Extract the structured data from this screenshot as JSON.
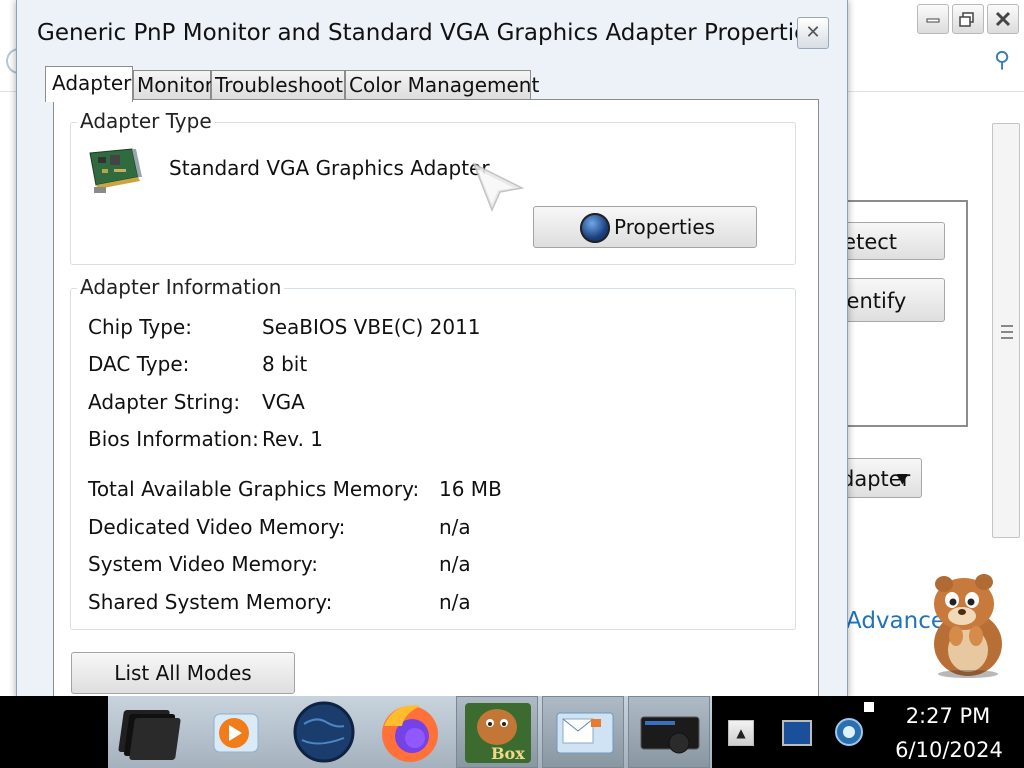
{
  "dialog": {
    "title": "Generic PnP Monitor and Standard VGA Graphics Adapter Properties",
    "close_glyph": "✕"
  },
  "tabs": [
    {
      "label": "Adapter",
      "active": true
    },
    {
      "label": "Monitor",
      "active": false
    },
    {
      "label": "Troubleshoot",
      "active": false
    },
    {
      "label": "Color Management",
      "active": false
    }
  ],
  "adapter_type": {
    "legend": "Adapter Type",
    "name": "Standard VGA Graphics Adapter",
    "properties_label": "Properties",
    "icon": "graphics-card-icon"
  },
  "adapter_info": {
    "legend": "Adapter Information",
    "rows": [
      {
        "label": "Chip Type:",
        "value": "SeaBIOS VBE(C) 2011"
      },
      {
        "label": "DAC Type:",
        "value": "8 bit"
      },
      {
        "label": "Adapter String:",
        "value": "VGA"
      },
      {
        "label": "Bios Information:",
        "value": "Rev. 1"
      }
    ],
    "memory": [
      {
        "label": "Total Available Graphics Memory:",
        "value": "16 MB"
      },
      {
        "label": "Dedicated Video Memory:",
        "value": "n/a"
      },
      {
        "label": "System Video Memory:",
        "value": "n/a"
      },
      {
        "label": "Shared System Memory:",
        "value": "n/a"
      }
    ]
  },
  "list_all_modes_label": "List All Modes",
  "background": {
    "detect_label": "Detect",
    "identify_label": "Identify",
    "adapter_dropdown_label": "Adapter",
    "advanced_link": "Advanced settings"
  },
  "taskbar": {
    "items": [
      "file-manager-icon",
      "media-player-icon",
      "globe-icon",
      "firefox-icon",
      "box-app-icon",
      "mail-icon",
      "display-icon"
    ],
    "box_label": "Box",
    "time": "2:27 PM",
    "date": "6/10/2024"
  },
  "colors": {
    "dialog_bg": "#ecf2f8",
    "link": "#1e73be",
    "taskbar": "#000000"
  }
}
